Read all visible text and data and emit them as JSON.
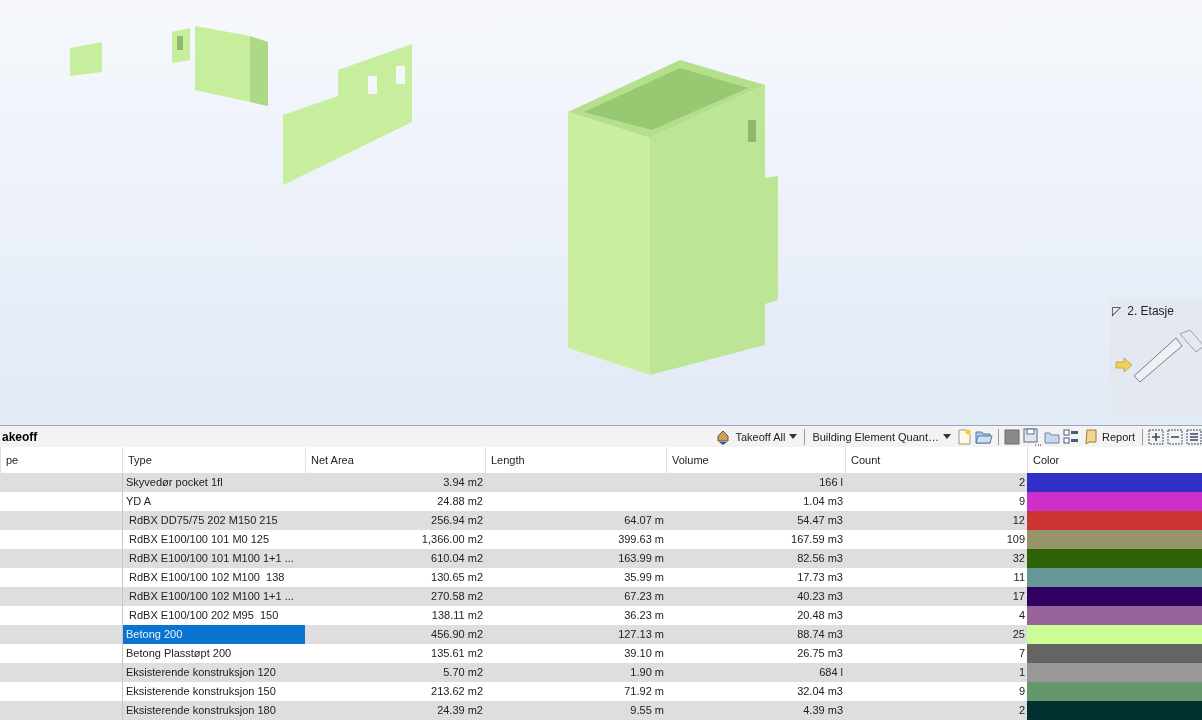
{
  "viewport": {
    "floor_label": "2. Etasje",
    "floor_marker": "◸"
  },
  "panel": {
    "title": "akeoff"
  },
  "toolbar": {
    "takeoff_menu": "Takeoff All",
    "quantity_menu": "Building Element Quant…",
    "report_button": "Report"
  },
  "table": {
    "columns": [
      "pe",
      "Type",
      "Net Area",
      "Length",
      "Volume",
      "Count",
      "Color"
    ],
    "rows": [
      {
        "type": "Skyvedør pocket 1fl",
        "net_area": "3.94 m2",
        "volume": "166 l",
        "count": "2",
        "color": "#3030c8",
        "selected": false
      },
      {
        "type": "YD A",
        "net_area": "24.88 m2",
        "volume": "1.04 m3",
        "count": "9",
        "color": "#cc30c8",
        "selected": false
      },
      {
        "type": " RdBX DD75/75 202 M150 215",
        "net_area": "256.94 m2",
        "length": "64.07 m",
        "volume": "54.47 m3",
        "count": "12",
        "color": "#cc3333",
        "selected": false
      },
      {
        "type": " RdBX E100/100 101 M0 125",
        "net_area": "1,366.00 m2",
        "length": "399.63 m",
        "volume": "167.59 m3",
        "count": "109",
        "color": "#98946a",
        "selected": false
      },
      {
        "type": " RdBX E100/100 101 M100 1+1 ...",
        "net_area": "610.04 m2",
        "length": "163.99 m",
        "volume": "82.56 m3",
        "count": "32",
        "color": "#2f6204",
        "selected": false
      },
      {
        "type": " RdBX E100/100 102 M100  138",
        "net_area": "130.65 m2",
        "length": "35.99 m",
        "volume": "17.73 m3",
        "count": "11",
        "color": "#649896",
        "selected": false
      },
      {
        "type": " RdBX E100/100 102 M100 1+1 ...",
        "net_area": "270.58 m2",
        "length": "67.23 m",
        "volume": "40.23 m3",
        "count": "17",
        "color": "#300060",
        "selected": false
      },
      {
        "type": " RdBX E100/100 202 M95  150",
        "net_area": "138.11 m2",
        "length": "36.23 m",
        "volume": "20.48 m3",
        "count": "4",
        "color": "#98649a",
        "selected": false
      },
      {
        "type": "Betong 200",
        "net_area": "456.90 m2",
        "length": "127.13 m",
        "volume": "88.74 m3",
        "count": "25",
        "color": "#ccfe98",
        "selected": true
      },
      {
        "type": "Betong Plasstøpt 200",
        "net_area": "135.61 m2",
        "length": "39.10 m",
        "volume": "26.75 m3",
        "count": "7",
        "color": "#646464",
        "selected": false
      },
      {
        "type": "Eksisterende konstruksjon 120",
        "net_area": "5.70 m2",
        "length": "1.90 m",
        "volume": "684 l",
        "count": "1",
        "color": "#989898",
        "selected": false
      },
      {
        "type": "Eksisterende konstruksjon 150",
        "net_area": "213.62 m2",
        "length": "71.92 m",
        "volume": "32.04 m3",
        "count": "9",
        "color": "#64986a",
        "selected": false
      },
      {
        "type": "Eksisterende konstruksjon 180",
        "net_area": "24.39 m2",
        "length": "9.55 m",
        "volume": "4.39 m3",
        "count": "2",
        "color": "#003030",
        "selected": false
      }
    ]
  }
}
